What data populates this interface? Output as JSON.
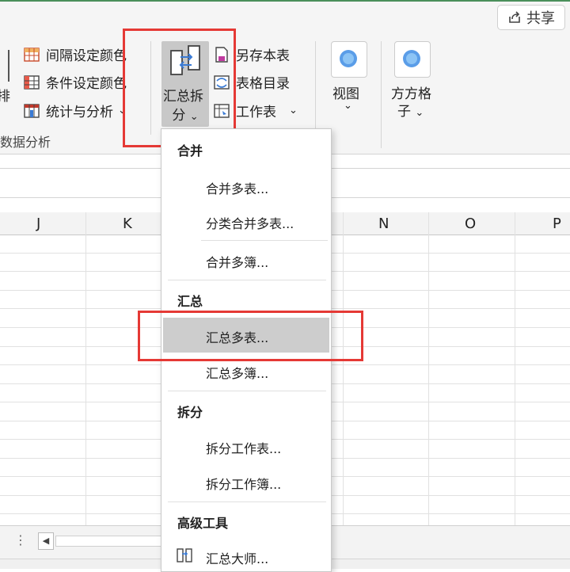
{
  "ribbon": {
    "share_label": "共享",
    "left_edge_label": "排",
    "group_label": "数据分析",
    "cmd_interval_color": "间隔设定颜色",
    "cmd_condition_color": "条件设定颜色",
    "cmd_stats": "统计与分析",
    "summary_split_line1": "汇总拆",
    "summary_split_line2": "分",
    "cmd_save_table": "另存本表",
    "cmd_table_index": "表格目录",
    "cmd_worksheet": "工作表",
    "view_label": "视图",
    "grid_line1": "方方格",
    "grid_line2": "子"
  },
  "sheet": {
    "columns": [
      "J",
      "K",
      "N",
      "O",
      "P"
    ]
  },
  "menu": {
    "section_merge": "合并",
    "merge_multi_sheets": "合并多表...",
    "category_merge": "分类合并多表...",
    "merge_multi_books": "合并多簿...",
    "section_summary": "汇总",
    "summary_multi_sheets": "汇总多表...",
    "summary_multi_books": "汇总多簿...",
    "section_split": "拆分",
    "split_worksheet": "拆分工作表...",
    "split_workbook": "拆分工作簿...",
    "section_advanced": "高级工具",
    "summary_master": "汇总大师..."
  },
  "colors": {
    "highlight_red": "#e53935",
    "accent_blue": "#3a7bd5"
  }
}
